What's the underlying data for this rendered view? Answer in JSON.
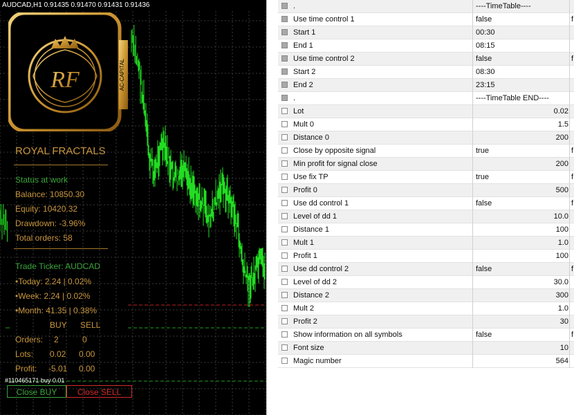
{
  "chart": {
    "symbol": "AUDCAD,H1  0.91435 0.91470 0.91431 0.91436",
    "logo_initials": "RF",
    "logo_side": "AC-CAPITAL",
    "title": "ROYAL FRACTALS",
    "status": "Status at work",
    "balance": "Balance: 10850.30",
    "equity": "Equity: 10420.32",
    "drawdown": "Drawdown: -3.96%",
    "total_orders": "Total orders: 58",
    "ticker": "Trade Ticker: AUDCAD",
    "today": "•Today: 2.24 | 0.02%",
    "week": "•Week: 2.24 | 0.02%",
    "month": "•Month: 41.35 | 0.38%",
    "buy_hdr": "BUY",
    "sell_hdr": "SELL",
    "orders_label": "Orders:",
    "orders_buy": "2",
    "orders_sell": "0",
    "lots_label": "Lots:",
    "lots_buy": "0.02",
    "lots_sell": "0.00",
    "profit_label": "Profit:",
    "profit_buy": "-5.01",
    "profit_sell": "0.00",
    "order_tag": "#110465171 buy 0.01",
    "close_buy": "Close BUY",
    "close_sell": "Close SELL",
    "colors": {
      "gold": "#c8963e",
      "green": "#3aa63a",
      "red": "#d42a2a",
      "candle": "#22dd22"
    }
  },
  "params": [
    {
      "name": ".",
      "value": "----TimeTable----",
      "shade": true,
      "grey": true,
      "tail": ""
    },
    {
      "name": "Use time control 1",
      "value": "false",
      "shade": false,
      "grey": true,
      "tail": "f"
    },
    {
      "name": "Start 1",
      "value": "00:30",
      "shade": true,
      "grey": true,
      "tail": ""
    },
    {
      "name": "End 1",
      "value": "08:15",
      "shade": false,
      "grey": true,
      "tail": ""
    },
    {
      "name": "Use time control 2",
      "value": "false",
      "shade": true,
      "grey": true,
      "tail": "f"
    },
    {
      "name": "Start 2",
      "value": "08:30",
      "shade": false,
      "grey": true,
      "tail": ""
    },
    {
      "name": "End 2",
      "value": "23:15",
      "shade": true,
      "grey": true,
      "tail": ""
    },
    {
      "name": ".",
      "value": "----TimeTable END----",
      "shade": false,
      "grey": true,
      "tail": ""
    },
    {
      "name": "Lot",
      "value": "0.02",
      "shade": true,
      "grey": false,
      "num": true,
      "tail": ""
    },
    {
      "name": "Mult 0",
      "value": "1.5",
      "shade": false,
      "grey": false,
      "num": true,
      "tail": ""
    },
    {
      "name": "Distance 0",
      "value": "200",
      "shade": true,
      "grey": false,
      "num": true,
      "tail": ""
    },
    {
      "name": "Close by opposite signal",
      "value": "true",
      "shade": false,
      "grey": false,
      "tail": "f"
    },
    {
      "name": "Min profit for signal close",
      "value": "200",
      "shade": true,
      "grey": false,
      "num": true,
      "tail": ""
    },
    {
      "name": "Use fix TP",
      "value": "true",
      "shade": false,
      "grey": false,
      "tail": "f"
    },
    {
      "name": "Profit 0",
      "value": "500",
      "shade": true,
      "grey": false,
      "num": true,
      "tail": ""
    },
    {
      "name": "Use dd control 1",
      "value": "false",
      "shade": false,
      "grey": false,
      "tail": "f"
    },
    {
      "name": "Level of dd 1",
      "value": "10.0",
      "shade": true,
      "grey": false,
      "num": true,
      "tail": ""
    },
    {
      "name": "Distance 1",
      "value": "100",
      "shade": false,
      "grey": false,
      "num": true,
      "tail": ""
    },
    {
      "name": "Mult 1",
      "value": "1.0",
      "shade": true,
      "grey": false,
      "num": true,
      "tail": ""
    },
    {
      "name": "Profit 1",
      "value": "100",
      "shade": false,
      "grey": false,
      "num": true,
      "tail": ""
    },
    {
      "name": "Use dd control 2",
      "value": "false",
      "shade": true,
      "grey": false,
      "tail": "f"
    },
    {
      "name": "Level of dd 2",
      "value": "30.0",
      "shade": false,
      "grey": false,
      "num": true,
      "tail": ""
    },
    {
      "name": "Distance 2",
      "value": "300",
      "shade": true,
      "grey": false,
      "num": true,
      "tail": ""
    },
    {
      "name": "Mult 2",
      "value": "1.0",
      "shade": false,
      "grey": false,
      "num": true,
      "tail": ""
    },
    {
      "name": "Profit 2",
      "value": "30",
      "shade": true,
      "grey": false,
      "num": true,
      "tail": ""
    },
    {
      "name": "Show information on all symbols",
      "value": "false",
      "shade": false,
      "grey": false,
      "tail": "f"
    },
    {
      "name": "Font size",
      "value": "10",
      "shade": true,
      "grey": false,
      "num": true,
      "tail": ""
    },
    {
      "name": "Magic number",
      "value": "564",
      "shade": false,
      "grey": false,
      "num": true,
      "tail": ""
    }
  ]
}
